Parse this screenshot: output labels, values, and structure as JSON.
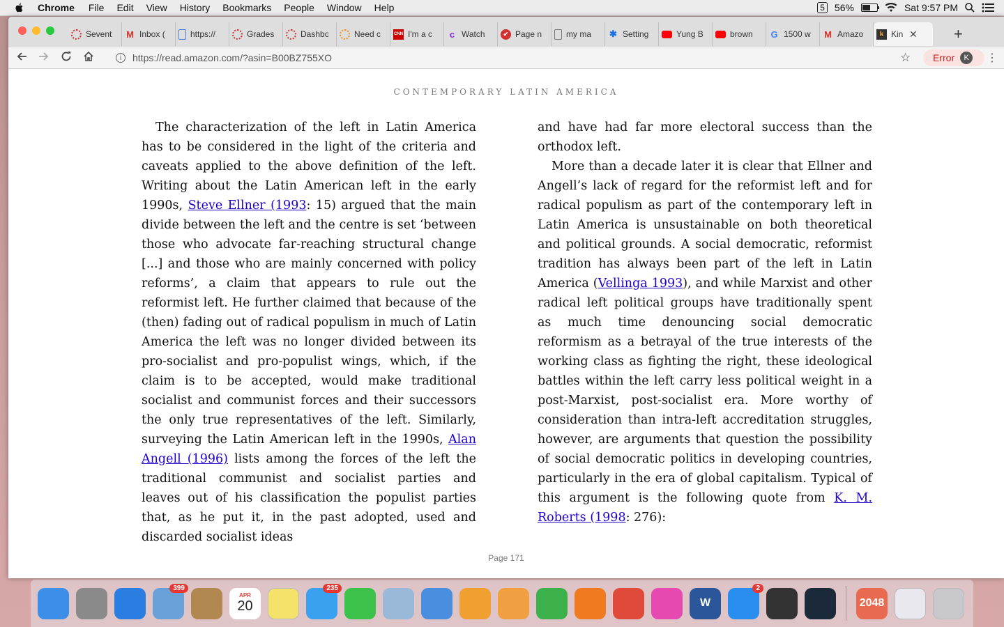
{
  "menubar": {
    "app_name": "Chrome",
    "menus": [
      "File",
      "Edit",
      "View",
      "History",
      "Bookmarks",
      "People",
      "Window",
      "Help"
    ],
    "battery_percent": "56%",
    "battery_level": 0.56,
    "clock": "Sat 9:57 PM"
  },
  "tabs": [
    {
      "title": "Sevent",
      "icon": "red-circle-icon"
    },
    {
      "title": "Inbox (",
      "icon": "gmail-icon"
    },
    {
      "title": "https://",
      "icon": "document-icon"
    },
    {
      "title": "Grades",
      "icon": "red-circle-icon"
    },
    {
      "title": "Dashbo",
      "icon": "red-circle-icon"
    },
    {
      "title": "Need c",
      "icon": "orange-circle-icon"
    },
    {
      "title": "I'm a c",
      "icon": "cnn-icon"
    },
    {
      "title": "Watch",
      "icon": "purple-c-icon"
    },
    {
      "title": "Page n",
      "icon": "red-check-icon"
    },
    {
      "title": "my ma",
      "icon": "file-icon"
    },
    {
      "title": "Setting",
      "icon": "gear-icon"
    },
    {
      "title": "Yung B",
      "icon": "youtube-icon"
    },
    {
      "title": "brown",
      "icon": "youtube-icon"
    },
    {
      "title": "1500 w",
      "icon": "google-icon"
    },
    {
      "title": "Amazo",
      "icon": "gmail-icon"
    },
    {
      "title": "Kin",
      "icon": "kindle-icon",
      "active": true
    }
  ],
  "toolbar": {
    "url": "https://read.amazon.com/?asin=B00BZ755XO",
    "error_label": "Error",
    "profile_initial": "K"
  },
  "book": {
    "running_head": "CONTEMPORARY LATIN AMERICA",
    "page_label": "Page 171",
    "left": {
      "t1": "The characterization of the left in Latin America has to be considered in the light of the criteria and caveats applied to the above definition of the left. Writing about the Latin American left in the early 1990s, ",
      "l1": "Steve Ellner (1993",
      "t2": ": 15) argued that the main divide between the left and the centre is set ‘between those who advocate far-reaching structural change [...] and those who are mainly concerned with policy reforms’, a claim that appears to rule out the reformist left. He further claimed that because of the (then) fading out of radical populism in much of Latin America the left was no longer divided between its pro-socialist and pro-populist wings, which, if the claim is to be accepted, would make traditional socialist and communist forces and their successors the only true representatives of the left. Similarly, surveying the Latin American left in the 1990s, ",
      "l2": "Alan Angell (1996)",
      "t3": " lists among the forces of the left the traditional communist and socialist parties and leaves out of his classification the populist parties that, as he put it, in the past adopted, used and discarded socialist ideas"
    },
    "right": {
      "p1": "and have had far more electoral success than the orthodox left.",
      "t1": "More than a decade later it is clear that Ellner and Angell’s lack of regard for the reformist left and for radical populism as part of the contemporary left in Latin America is unsustainable on both theoretical and political grounds. A social democratic, reformist tradition has always been part of the left in Latin America (",
      "l1": "Vellinga 1993",
      "t2": "), and while Marxist and other radical left political groups have traditionally spent as much time denouncing social democratic reformism as a betrayal of the true interests of the working class as fighting the right, these ideological battles within the left carry less political weight in a post-Marxist, post-socialist era. More worthy of consideration than intra-left accreditation struggles, however, are arguments that question the possibility of social democratic politics in developing countries, particularly in the era of global capitalism. Typical of this argument is the following quote from ",
      "l2": "K. M. Roberts (1998",
      "t3": ": 276):"
    }
  },
  "dock": [
    {
      "name": "finder",
      "color": "#3c8ee8",
      "label": ""
    },
    {
      "name": "launchpad",
      "color": "#8a8a8a",
      "label": ""
    },
    {
      "name": "safari",
      "color": "#2a7de1",
      "label": ""
    },
    {
      "name": "mail",
      "color": "#6aa0d8",
      "label": "",
      "badge": "399"
    },
    {
      "name": "contacts",
      "color": "#b08850",
      "label": ""
    },
    {
      "name": "calendar",
      "color": "#ffffff",
      "label": "20",
      "month": "APR"
    },
    {
      "name": "notes",
      "color": "#f5e26a",
      "label": ""
    },
    {
      "name": "messages",
      "color": "#3aa0f0",
      "label": "",
      "badge": "235"
    },
    {
      "name": "facetime",
      "color": "#3cc24a",
      "label": ""
    },
    {
      "name": "preview",
      "color": "#9ab8d8",
      "label": ""
    },
    {
      "name": "keynote",
      "color": "#4a8ee0",
      "label": ""
    },
    {
      "name": "photos",
      "color": "#f0a030",
      "label": ""
    },
    {
      "name": "pages",
      "color": "#f0a040",
      "label": ""
    },
    {
      "name": "numbers",
      "color": "#3cb04a",
      "label": ""
    },
    {
      "name": "ibooks",
      "color": "#f07a20",
      "label": ""
    },
    {
      "name": "chrome",
      "color": "#e04a3a",
      "label": ""
    },
    {
      "name": "itunes",
      "color": "#e64ab0",
      "label": ""
    },
    {
      "name": "word",
      "color": "#2b579a",
      "label": "W"
    },
    {
      "name": "app-store",
      "color": "#2a8ef0",
      "label": "",
      "badge": "2"
    },
    {
      "name": "screenium",
      "color": "#333333",
      "label": ""
    },
    {
      "name": "kindle",
      "color": "#1a2a3a",
      "label": ""
    },
    {
      "name": "2048",
      "color": "#e86a50",
      "label": "2048"
    },
    {
      "name": "word-document",
      "color": "#e8e8ee",
      "label": ""
    },
    {
      "name": "trash",
      "color": "#c8c8cc",
      "label": ""
    }
  ]
}
